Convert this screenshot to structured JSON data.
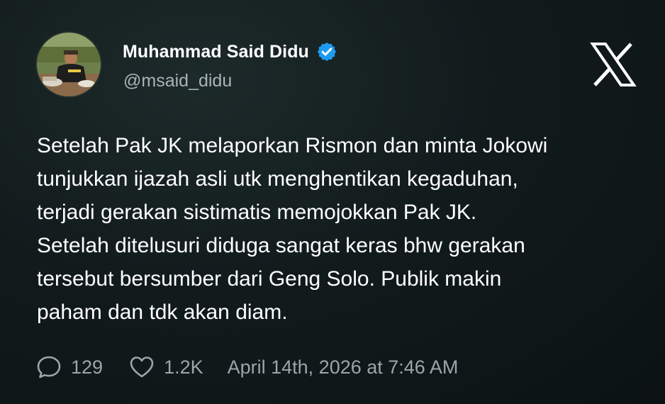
{
  "author": {
    "name": "Muhammad Said Didu",
    "handle": "@msaid_didu",
    "verified": true,
    "verified_color": "#1d9bf0"
  },
  "platform_logo": "x-logo-icon",
  "tweet": {
    "text": "Setelah Pak JK melaporkan Rismon dan minta Jokowi\ntunjukkan ijazah asli utk menghentikan kegaduhan,\nterjadi gerakan sistimatis memojokkan Pak JK.\nSetelah ditelusuri diduga sangat keras bhw gerakan\ntersebut bersumber dari Geng Solo. Publik makin\npaham dan tdk akan diam."
  },
  "stats": {
    "replies": "129",
    "likes": "1.2K",
    "timestamp": "April 14th, 2026 at 7:46 AM"
  },
  "icons": {
    "reply": "speech-bubble-icon",
    "like": "heart-icon",
    "verified": "verified-badge-icon"
  },
  "colors": {
    "background": "#121b1c",
    "text": "#ffffff",
    "muted": "#9aa6aa"
  }
}
